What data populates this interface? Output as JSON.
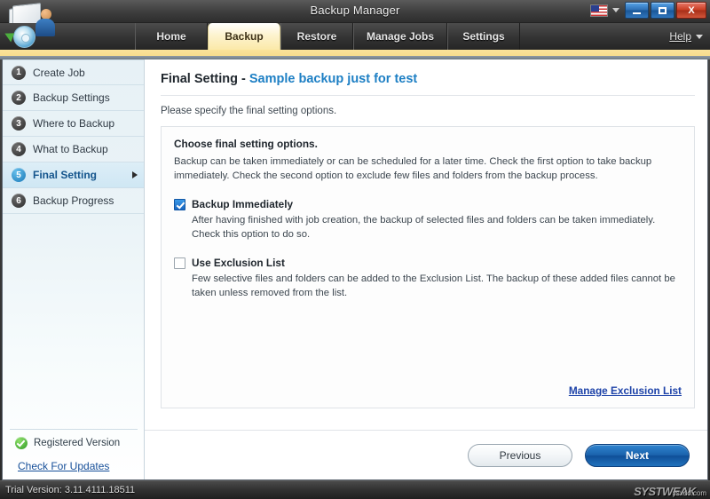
{
  "window": {
    "title": "Backup Manager",
    "minimize_label": "Minimize",
    "maximize_label": "Maximize",
    "close_label": "X",
    "language_icon": "us-flag-icon"
  },
  "tabs": [
    {
      "label": "Home",
      "active": false
    },
    {
      "label": "Backup",
      "active": true
    },
    {
      "label": "Restore",
      "active": false
    },
    {
      "label": "Manage Jobs",
      "active": false
    },
    {
      "label": "Settings",
      "active": false
    }
  ],
  "help": {
    "label": "Help"
  },
  "sidebar": {
    "items": [
      {
        "num": "1",
        "label": "Create Job",
        "active": false
      },
      {
        "num": "2",
        "label": "Backup Settings",
        "active": false
      },
      {
        "num": "3",
        "label": "Where to Backup",
        "active": false
      },
      {
        "num": "4",
        "label": "What to Backup",
        "active": false
      },
      {
        "num": "5",
        "label": "Final Setting",
        "active": true
      },
      {
        "num": "6",
        "label": "Backup Progress",
        "active": false
      }
    ],
    "registered_label": "Registered Version",
    "check_updates_label": "Check For Updates"
  },
  "content": {
    "title_main": "Final Setting - ",
    "title_accent": "Sample backup just for test",
    "subtitle": "Please specify the final setting options.",
    "panel": {
      "heading": "Choose final setting options.",
      "description": "Backup can be taken immediately or can be scheduled for a later time. Check the first option to take backup immediately. Check the second option to exclude few files and folders from the backup process.",
      "options": [
        {
          "label": "Backup Immediately",
          "checked": true,
          "description": "After having finished with job creation, the backup of selected files and folders can be taken immediately. Check this option to do so."
        },
        {
          "label": "Use Exclusion List",
          "checked": false,
          "description": "Few selective files and folders can be added to the Exclusion List. The backup of these added files cannot be taken unless removed from the list."
        }
      ],
      "exclusion_link": "Manage Exclusion List"
    }
  },
  "footer": {
    "previous_label": "Previous",
    "next_label": "Next"
  },
  "statusbar": {
    "trial_text": "Trial Version: 3.11.4111.18511",
    "watermark": "SYSTWEAK",
    "watermark_sub": "ysxdd.com"
  },
  "colors": {
    "accent_blue": "#1d7fc4",
    "tab_active": "#fbe9a8",
    "primary_button": "#1b63ad",
    "link": "#1d42a8"
  }
}
